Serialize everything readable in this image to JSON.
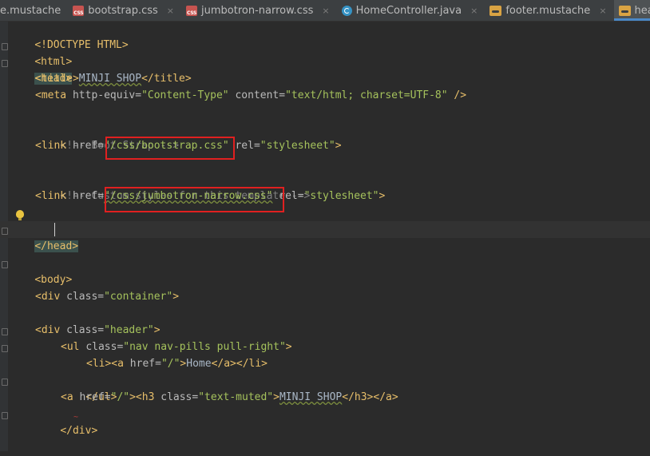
{
  "tabs": [
    {
      "label": "e.mustache",
      "icon": "mustache-icon",
      "active": false
    },
    {
      "label": "bootstrap.css",
      "icon": "css-file-icon",
      "active": false
    },
    {
      "label": "jumbotron-narrow.css",
      "icon": "css-file-icon",
      "active": false
    },
    {
      "label": "HomeController.java",
      "icon": "java-class-icon",
      "active": false
    },
    {
      "label": "footer.mustache",
      "icon": "mustache-icon",
      "active": false
    },
    {
      "label": "header.mustache",
      "icon": "mustache-icon",
      "active": true
    }
  ],
  "close_glyph": "×",
  "css_icon_text": "CSS",
  "code": {
    "l1": {
      "t1": "<!DOCTYPE HTML>"
    },
    "l2": {
      "t1": "<html>"
    },
    "l3": {
      "t1": "<head>"
    },
    "l4": {
      "t1": "<title>",
      "t2": "MINJI SHOP",
      "t3": "</title>"
    },
    "l5": {
      "t1": "<meta ",
      "t2": "http-equiv=",
      "t3": "\"Content-Type\"",
      "t4": " content=",
      "t5": "\"text/html; charset=UTF-8\"",
      "t6": " />"
    },
    "l7": {
      "t1": "<!-- Boot Strap -->"
    },
    "l8": {
      "t1": "<link ",
      "t2": "href=",
      "t3": "\"/css/bootstrap.css\"",
      "t4": " rel=",
      "t5": "\"stylesheet\"",
      "t6": ">"
    },
    "l10": {
      "t1": "<!-- Custom styles for this template -->"
    },
    "l11": {
      "t1": "<link ",
      "t2": "href=",
      "t3": "\"/css/jumbotron-narrow.css\"",
      "t4": " rel=",
      "t5": "\"stylesheet\"",
      "t6": ">"
    },
    "l13": {
      "t1": "</head>"
    },
    "l15": {
      "t1": "<body>"
    },
    "l17": {
      "t1": "<div ",
      "t2": "class=",
      "t3": "\"container\"",
      "t4": ">"
    },
    "l19": {
      "t1": "<div ",
      "t2": "class=",
      "t3": "\"header\"",
      "t4": ">"
    },
    "l20": {
      "t1": "<ul ",
      "t2": "class=",
      "t3": "\"nav nav-pills pull-right\"",
      "t4": ">"
    },
    "l21": {
      "t1": "<li><a ",
      "t2": "href=",
      "t3": "\"/\"",
      "t4": ">",
      "t5": "Home",
      "t6": "</a></li>"
    },
    "l22": {
      "t1": "</ul>"
    },
    "l23": {
      "t1": "<a ",
      "t2": "href=",
      "t3": "\"/\"",
      "t4": "><h3 ",
      "t5": "class=",
      "t6": "\"text-muted\"",
      "t7": ">",
      "t8": "MINJI SHOP",
      "t9": "</h3></a>"
    },
    "l24": {
      "t1": "</div>",
      "t2": "~"
    }
  },
  "colors": {
    "tag": "#e8bf6a",
    "value": "#a5c25c",
    "comment": "#808080",
    "highlight_box": "#e02020",
    "active_tab_underline": "#4a88c7"
  }
}
